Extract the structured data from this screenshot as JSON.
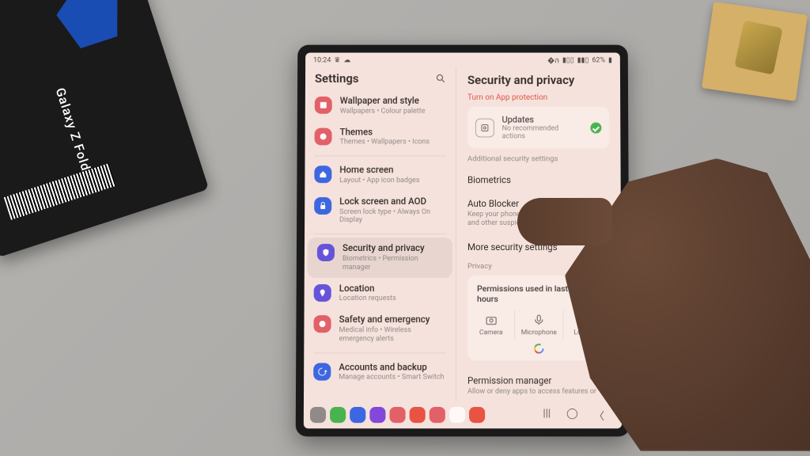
{
  "prop": {
    "box_label": "Galaxy Z Fold6"
  },
  "status": {
    "time": "10:24",
    "battery": "62%"
  },
  "left": {
    "title": "Settings",
    "items": [
      {
        "title": "Wallpaper and style",
        "sub": "Wallpapers • Colour palette",
        "color": "#e15b64",
        "icon": "image"
      },
      {
        "title": "Themes",
        "sub": "Themes • Wallpapers • Icons",
        "color": "#e15b64",
        "icon": "palette"
      },
      {
        "title": "Home screen",
        "sub": "Layout • App icon badges",
        "color": "#2e62e6",
        "icon": "home"
      },
      {
        "title": "Lock screen and AOD",
        "sub": "Screen lock type • Always On Display",
        "color": "#2e62e6",
        "icon": "lock"
      },
      {
        "title": "Security and privacy",
        "sub": "Biometrics • Permission manager",
        "color": "#5a4ee0",
        "icon": "shield",
        "selected": true
      },
      {
        "title": "Location",
        "sub": "Location requests",
        "color": "#5a4ee0",
        "icon": "pin"
      },
      {
        "title": "Safety and emergency",
        "sub": "Medical info • Wireless emergency alerts",
        "color": "#e15b64",
        "icon": "sos"
      },
      {
        "title": "Accounts and backup",
        "sub": "Manage accounts • Smart Switch",
        "color": "#2e62e6",
        "icon": "sync"
      }
    ]
  },
  "right": {
    "title": "Security and privacy",
    "app_protection_link": "Turn on App protection",
    "updates": {
      "title": "Updates",
      "sub": "No recommended actions"
    },
    "section_additional": "Additional security settings",
    "biometrics": "Biometrics",
    "auto_blocker": {
      "title": "Auto Blocker",
      "sub": "Keep your phone safe by blocking threats and other suspicious activity."
    },
    "more_security": "More security settings",
    "section_privacy": "Privacy",
    "perms_24h": "Permissions used in last 24 hours",
    "perm_items": [
      {
        "label": "Camera"
      },
      {
        "label": "Microphone"
      },
      {
        "label": "Location"
      }
    ],
    "perm_manager": {
      "title": "Permission manager",
      "sub": "Allow or deny apps to access features or"
    }
  },
  "dock_colors": [
    "#888",
    "#3bb54a",
    "#2e62e6",
    "#7a3fe0",
    "#e15b64",
    "#e84c3d",
    "#e15b64",
    "#fff",
    "#e84c3d"
  ]
}
